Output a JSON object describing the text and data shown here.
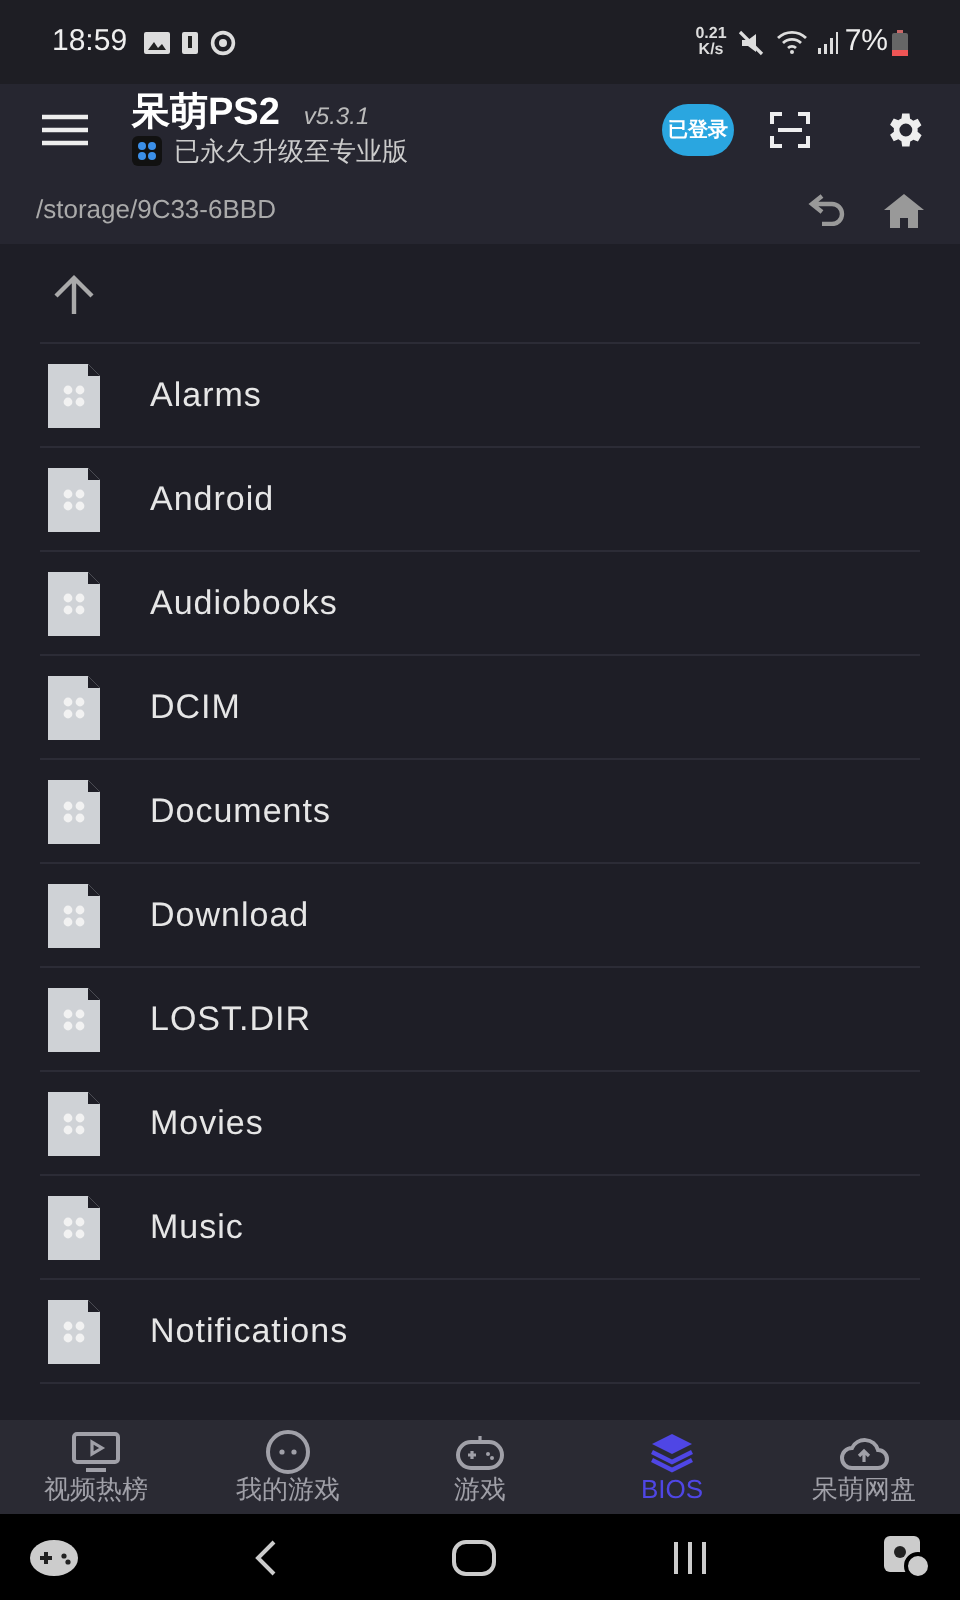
{
  "status_bar": {
    "time": "18:59",
    "net_speed": "0.21",
    "net_unit": "K/s",
    "battery": "7%"
  },
  "header": {
    "title": "呆萌PS2",
    "version": "v5.3.1",
    "subtitle": "已永久升级至专业版",
    "badge": "已登录"
  },
  "path": "/storage/9C33-6BBD",
  "files": [
    {
      "name": "Alarms"
    },
    {
      "name": "Android"
    },
    {
      "name": "Audiobooks"
    },
    {
      "name": "DCIM"
    },
    {
      "name": "Documents"
    },
    {
      "name": "Download"
    },
    {
      "name": "LOST.DIR"
    },
    {
      "name": "Movies"
    },
    {
      "name": "Music"
    },
    {
      "name": "Notifications"
    }
  ],
  "bottom_nav": [
    {
      "label": "视频热榜",
      "kind": "tv",
      "selected": false
    },
    {
      "label": "我的游戏",
      "kind": "face",
      "selected": false
    },
    {
      "label": "游戏",
      "kind": "gamepad",
      "selected": false
    },
    {
      "label": "BIOS",
      "kind": "layers",
      "selected": true
    },
    {
      "label": "呆萌网盘",
      "kind": "cloud",
      "selected": false
    }
  ]
}
